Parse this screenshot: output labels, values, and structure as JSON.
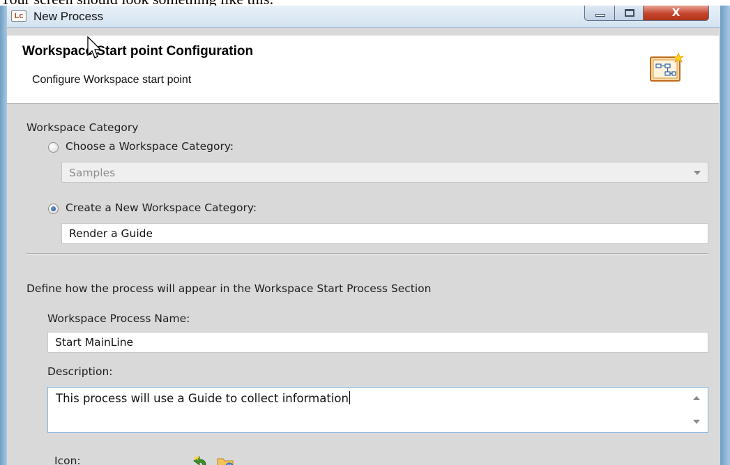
{
  "caption": "Your screen should look something like this:",
  "window": {
    "app_icon_text": "Lc",
    "title": "New Process",
    "controls": {
      "minimize": "minimize-button",
      "maximize": "maximize-button",
      "close_glyph": "X"
    }
  },
  "header": {
    "title": "Workspace Start point Configuration",
    "subtitle": "Configure Workspace start point",
    "icon": "process-diagram-icon"
  },
  "category_section": {
    "heading": "Workspace Category",
    "choose_option": {
      "label": "Choose a Workspace Category:",
      "selected": false
    },
    "category_select": {
      "value": "Samples",
      "enabled": false
    },
    "create_option": {
      "label": "Create a New Workspace Category:",
      "selected": true
    },
    "new_category_input": {
      "value": "Render a Guide"
    }
  },
  "process_section": {
    "heading": "Define how the process will appear in the Workspace Start Process Section",
    "name_label": "Workspace Process Name:",
    "name_input": {
      "value": "Start MainLine"
    },
    "description_label": "Description:",
    "description_input": {
      "value": "This process will use a Guide to collect information"
    },
    "icon_label": "Icon:",
    "icon_buttons": [
      "reset-icon",
      "browse-folder-icon"
    ]
  },
  "colors": {
    "panel_background": "#d9d9d9",
    "header_background": "#ffffff",
    "close_button": "#c4442c",
    "focus_border": "#8bb7dd"
  }
}
